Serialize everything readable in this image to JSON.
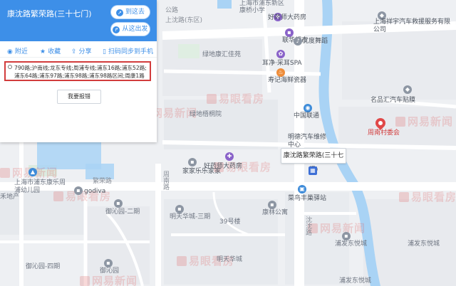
{
  "card": {
    "title": "康沈路繁荣路(三十七门)",
    "btn_to": "到这去",
    "btn_from": "从这出发",
    "btn_to_icon": "arrow-up-right-icon",
    "btn_from_icon": "route-icon",
    "actions": [
      {
        "icon": "location-icon",
        "label": "附近"
      },
      {
        "icon": "star-icon",
        "label": "收藏"
      },
      {
        "icon": "share-icon",
        "label": "分享"
      },
      {
        "icon": "phone-icon",
        "label": "扫码同步到手机"
      }
    ],
    "routes": "790路;沪南线;龙东专线;周浦专线;浦东16路;浦东52路;浦东64路;浦东97路;浦东98路;浦东98路区间;周康1路",
    "error_btn": "我要报错"
  },
  "map": {
    "stop_label": "康沈路繁荣路(三十七门)",
    "labels": [
      {
        "text": "公路",
        "kind": "road"
      },
      {
        "text": "上沈路(东区)",
        "kind": "road"
      },
      {
        "text": "上海市浦东新区",
        "kind": "normal"
      },
      {
        "text": "康桥小学",
        "kind": "normal"
      },
      {
        "text": "好药师大药房",
        "kind": "dark"
      },
      {
        "text": "上海祥宇汽车救援服务有限公司",
        "kind": "dark"
      },
      {
        "text": "联华超市",
        "kind": "dark"
      },
      {
        "text": "优度舞蹈",
        "kind": "dark"
      },
      {
        "text": "绿地康汇佳苑",
        "kind": "normal"
      },
      {
        "text": "耳净·采耳SPA",
        "kind": "dark"
      },
      {
        "text": "寿记海鲜瓷器",
        "kind": "dark"
      },
      {
        "text": "名品汇汽车贴膜",
        "kind": "dark"
      },
      {
        "text": "绿地梧桐院",
        "kind": "normal"
      },
      {
        "text": "中国联通",
        "kind": "dark"
      },
      {
        "text": "明德汽车维修中心",
        "kind": "dark"
      },
      {
        "text": "周南村委会",
        "kind": "red"
      },
      {
        "text": "好药师大药房",
        "kind": "dark"
      },
      {
        "text": "家家乐乐家家",
        "kind": "dark"
      },
      {
        "text": "繁荣路",
        "kind": "road"
      },
      {
        "text": "上海市浦东康乐周浦幼儿园",
        "kind": "normal"
      },
      {
        "text": "godiva",
        "kind": "dark"
      },
      {
        "text": "周南路",
        "kind": "road"
      },
      {
        "text": "御沁园-二期",
        "kind": "normal"
      },
      {
        "text": "明天华城-三期",
        "kind": "normal"
      },
      {
        "text": "39号楼",
        "kind": "normal"
      },
      {
        "text": "菜鸟丰巢驿站",
        "kind": "dark"
      },
      {
        "text": "康林公寓",
        "kind": "normal"
      },
      {
        "text": "沈沈路",
        "kind": "road"
      },
      {
        "text": "浦发东悦城",
        "kind": "normal"
      },
      {
        "text": "浦发东悦城",
        "kind": "normal"
      },
      {
        "text": "御沁园",
        "kind": "normal"
      },
      {
        "text": "御沁园-四期",
        "kind": "normal"
      },
      {
        "text": "明天华城",
        "kind": "normal"
      },
      {
        "text": "禾地产",
        "kind": "normal"
      },
      {
        "text": "浦发东悦城",
        "kind": "normal"
      }
    ],
    "watermarks": [
      "网易新闻",
      "易眼看房",
      "网易新闻",
      "易眼看房",
      "网易新闻",
      "易眼看房",
      "网易新闻",
      "易眼看房",
      "网易新闻",
      "易眼看房"
    ],
    "stop_icon": "bus-stop-icon",
    "colors": {
      "water": "#a9d3f5",
      "road": "#ffffff",
      "ground": "#eef0f3",
      "card_header": "#3d8fe8",
      "highlight": "#d23c3c"
    }
  }
}
